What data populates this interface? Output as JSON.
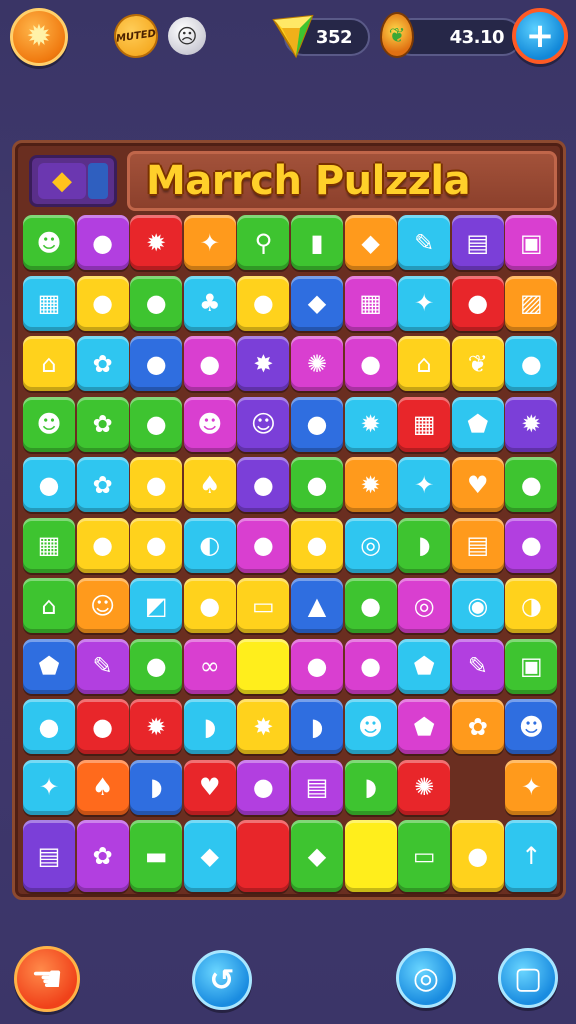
{
  "topbar": {
    "muted_label": "MUTED",
    "gem_count": "352",
    "coin_count": "43.10",
    "sun_icon": "sun-icon",
    "ghost_icon": "ghost-icon",
    "plus_icon": "plus-icon"
  },
  "board": {
    "title": "Marrch Pulzzla",
    "menu_icon": "diamond-icon"
  },
  "grid": {
    "rows": [
      [
        {
          "c": "#3ec430",
          "i": "☻"
        },
        {
          "c": "#b23fe0",
          "i": "●"
        },
        {
          "c": "#e8262a",
          "i": "✹"
        },
        {
          "c": "#ff9a1c",
          "i": "✦"
        },
        {
          "c": "#3ec430",
          "i": "⚲"
        },
        {
          "c": "#3ec430",
          "i": "▮"
        },
        {
          "c": "#ff9a1c",
          "i": "◆"
        },
        {
          "c": "#2fc6f0",
          "i": "✎"
        },
        {
          "c": "#7b3fd8",
          "i": "▤"
        },
        {
          "c": "#d93fd0",
          "i": "▣"
        }
      ],
      [
        {
          "c": "#2fc6f0",
          "i": "▦"
        },
        {
          "c": "#ffd21c",
          "i": "●"
        },
        {
          "c": "#3ec430",
          "i": "●"
        },
        {
          "c": "#2fc6f0",
          "i": "♣"
        },
        {
          "c": "#ffd21c",
          "i": "●"
        },
        {
          "c": "#2f6ee0",
          "i": "◆"
        },
        {
          "c": "#d93fd0",
          "i": "▦"
        },
        {
          "c": "#2fc6f0",
          "i": "✦"
        },
        {
          "c": "#e8262a",
          "i": "●"
        },
        {
          "c": "#ff9a1c",
          "i": "▨"
        }
      ],
      [
        {
          "c": "#ffd21c",
          "i": "⌂"
        },
        {
          "c": "#2fc6f0",
          "i": "✿"
        },
        {
          "c": "#2f6ee0",
          "i": "●"
        },
        {
          "c": "#d93fd0",
          "i": "●"
        },
        {
          "c": "#7b3fd8",
          "i": "✸"
        },
        {
          "c": "#d93fd0",
          "i": "✺"
        },
        {
          "c": "#d93fd0",
          "i": "●"
        },
        {
          "c": "#ffd21c",
          "i": "⌂"
        },
        {
          "c": "#ffd21c",
          "i": "❦"
        },
        {
          "c": "#2fc6f0",
          "i": "●"
        }
      ],
      [
        {
          "c": "#3ec430",
          "i": "☻"
        },
        {
          "c": "#3ec430",
          "i": "✿"
        },
        {
          "c": "#3ec430",
          "i": "●"
        },
        {
          "c": "#d93fd0",
          "i": "☻"
        },
        {
          "c": "#7b3fd8",
          "i": "☺"
        },
        {
          "c": "#2f6ee0",
          "i": "●"
        },
        {
          "c": "#2fc6f0",
          "i": "✹"
        },
        {
          "c": "#e8262a",
          "i": "▦"
        },
        {
          "c": "#2fc6f0",
          "i": "⬟"
        },
        {
          "c": "#7b3fd8",
          "i": "✹"
        }
      ],
      [
        {
          "c": "#2fc6f0",
          "i": "●"
        },
        {
          "c": "#2fc6f0",
          "i": "✿"
        },
        {
          "c": "#ffd21c",
          "i": "●"
        },
        {
          "c": "#ffd21c",
          "i": "♠"
        },
        {
          "c": "#7b3fd8",
          "i": "●"
        },
        {
          "c": "#3ec430",
          "i": "●"
        },
        {
          "c": "#ff9a1c",
          "i": "✹"
        },
        {
          "c": "#2fc6f0",
          "i": "✦"
        },
        {
          "c": "#ff9a1c",
          "i": "♥"
        },
        {
          "c": "#3ec430",
          "i": "●"
        }
      ],
      [
        {
          "c": "#3ec430",
          "i": "▦"
        },
        {
          "c": "#ffd21c",
          "i": "●"
        },
        {
          "c": "#ffd21c",
          "i": "●"
        },
        {
          "c": "#2fc6f0",
          "i": "◐"
        },
        {
          "c": "#d93fd0",
          "i": "●"
        },
        {
          "c": "#ffd21c",
          "i": "●"
        },
        {
          "c": "#2fc6f0",
          "i": "◎"
        },
        {
          "c": "#3ec430",
          "i": "◗"
        },
        {
          "c": "#ff9a1c",
          "i": "▤"
        },
        {
          "c": "#b23fe0",
          "i": "●"
        }
      ],
      [
        {
          "c": "#3ec430",
          "i": "⌂"
        },
        {
          "c": "#ff9a1c",
          "i": "☺"
        },
        {
          "c": "#2fc6f0",
          "i": "◩"
        },
        {
          "c": "#ffd21c",
          "i": "●"
        },
        {
          "c": "#ffd21c",
          "i": "▭"
        },
        {
          "c": "#2f6ee0",
          "i": "▲"
        },
        {
          "c": "#3ec430",
          "i": "●"
        },
        {
          "c": "#d93fd0",
          "i": "◎"
        },
        {
          "c": "#2fc6f0",
          "i": "◉"
        },
        {
          "c": "#ffd21c",
          "i": "◑"
        }
      ],
      [
        {
          "c": "#2f6ee0",
          "i": "⬟"
        },
        {
          "c": "#b23fe0",
          "i": "✎"
        },
        {
          "c": "#3ec430",
          "i": "●"
        },
        {
          "c": "#d93fd0",
          "i": "∞"
        },
        {
          "c": "#ffee1c",
          "i": ""
        },
        {
          "c": "#d93fd0",
          "i": "●"
        },
        {
          "c": "#d93fd0",
          "i": "●"
        },
        {
          "c": "#2fc6f0",
          "i": "⬟"
        },
        {
          "c": "#b23fe0",
          "i": "✎"
        },
        {
          "c": "#3ec430",
          "i": "▣"
        }
      ],
      [
        {
          "c": "#2fc6f0",
          "i": "●"
        },
        {
          "c": "#e8262a",
          "i": "●"
        },
        {
          "c": "#e8262a",
          "i": "✹"
        },
        {
          "c": "#2fc6f0",
          "i": "◗"
        },
        {
          "c": "#ffd21c",
          "i": "✸"
        },
        {
          "c": "#2f6ee0",
          "i": "◗"
        },
        {
          "c": "#2fc6f0",
          "i": "☻"
        },
        {
          "c": "#d93fd0",
          "i": "⬟"
        },
        {
          "c": "#ff9a1c",
          "i": "✿"
        },
        {
          "c": "#2f6ee0",
          "i": "☻"
        }
      ],
      [
        {
          "c": "#2fc6f0",
          "i": "✦"
        },
        {
          "c": "#ff6a1c",
          "i": "♠"
        },
        {
          "c": "#2f6ee0",
          "i": "◗"
        },
        {
          "c": "#e8262a",
          "i": "♥"
        },
        {
          "c": "#b23fe0",
          "i": "●"
        },
        {
          "c": "#b23fe0",
          "i": "▤"
        },
        {
          "c": "#3ec430",
          "i": "◗"
        },
        {
          "c": "#e8262a",
          "i": "✺"
        },
        {
          "c": "empty",
          "i": ""
        },
        {
          "c": "#ff9a1c",
          "i": "✦"
        }
      ],
      [
        {
          "c": "#7b3fd8",
          "i": "▤"
        },
        {
          "c": "#b23fe0",
          "i": "✿"
        },
        {
          "c": "#3ec430",
          "i": "▬"
        },
        {
          "c": "#2fc6f0",
          "i": "◆"
        },
        {
          "c": "#e8262a",
          "i": ""
        },
        {
          "c": "#3ec430",
          "i": "◆"
        },
        {
          "c": "#ffee1c",
          "i": ""
        },
        {
          "c": "#3ec430",
          "i": "▭"
        },
        {
          "c": "#ffd21c",
          "i": "●"
        },
        {
          "c": "#2fc6f0",
          "i": "↑"
        }
      ]
    ]
  },
  "bottom": {
    "back_icon": "back-hand-icon",
    "undo_icon": "undo-icon",
    "hint_icon": "hint-chat-icon",
    "stop_icon": "stop-square-icon"
  }
}
